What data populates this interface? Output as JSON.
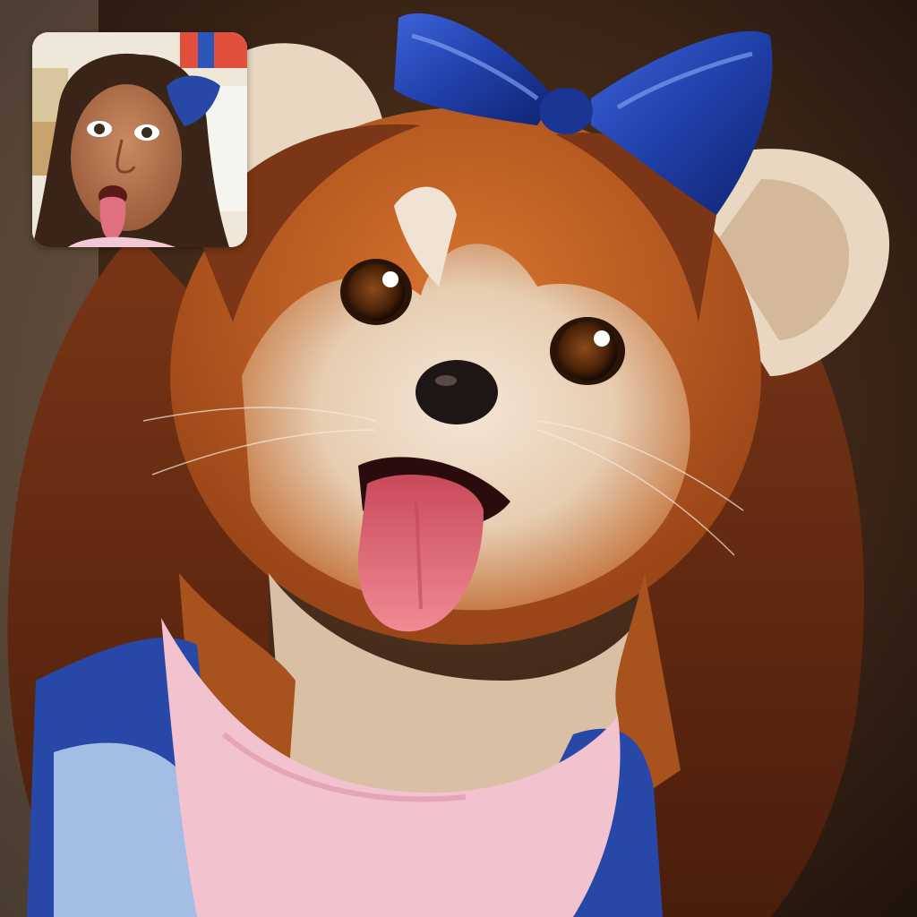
{
  "call": {
    "remote_video": {
      "subject": "dog",
      "icon": "remote-participant-video"
    },
    "self_view": {
      "subject": "person",
      "icon": "self-camera-preview"
    }
  },
  "colors": {
    "background_dark": "#2a1a10",
    "fur_orange": "#b85a22",
    "fur_light": "#f1e3d4",
    "hair_brown": "#6b2f14",
    "bow_blue": "#1f3fa8",
    "shirt_pink": "#f2c3cf",
    "shirt_blue": "#2848a8",
    "tongue_pink": "#e46a78"
  }
}
